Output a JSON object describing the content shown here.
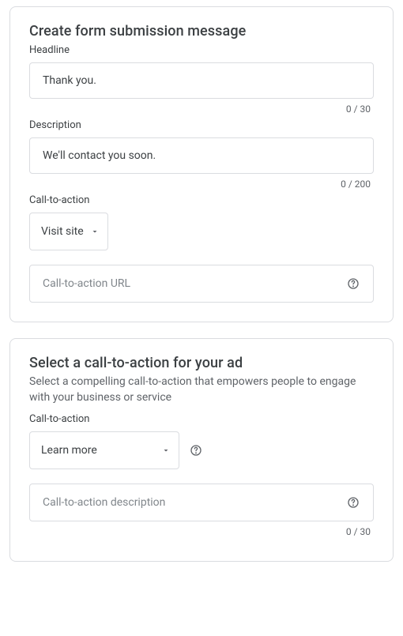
{
  "section1": {
    "title": "Create form submission message",
    "headline_label": "Headline",
    "headline_value": "Thank you.",
    "headline_counter": "0 / 30",
    "description_label": "Description",
    "description_value": "We'll contact you soon.",
    "description_counter": "0 / 200",
    "cta_label": "Call-to-action",
    "cta_dropdown_value": "Visit site",
    "cta_url_placeholder": "Call-to-action URL"
  },
  "section2": {
    "title": "Select a call-to-action for your ad",
    "subtitle": "Select a compelling call-to-action that empowers people to engage with your business or service",
    "cta_label": "Call-to-action",
    "cta_dropdown_value": "Learn more",
    "cta_desc_placeholder": "Call-to-action description",
    "cta_desc_counter": "0 / 30"
  }
}
